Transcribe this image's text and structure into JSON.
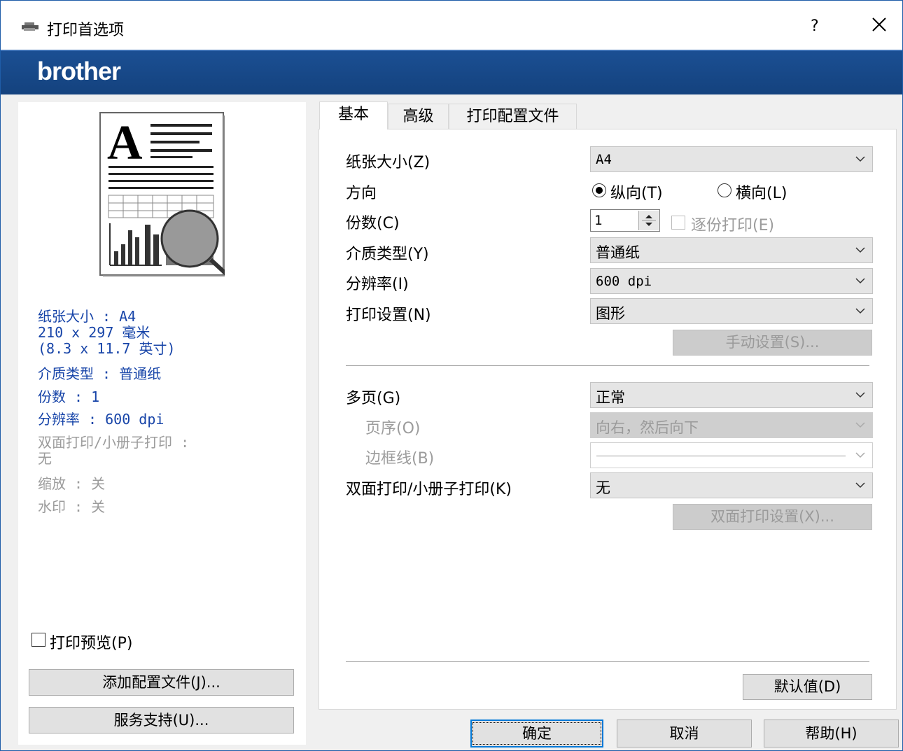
{
  "window": {
    "title": "打印首选项",
    "help": "?",
    "close": "✕"
  },
  "brand": {
    "logo": "brother"
  },
  "summary": {
    "paper_size": "纸张大小 : A4",
    "paper_dims": "210 x 297 毫米",
    "paper_inches": "(8.3 x 11.7 英寸)",
    "media_type": "介质类型 : 普通纸",
    "copies": "份数 : 1",
    "resolution": "分辨率 : 600 dpi",
    "duplex_line1": "双面打印/小册子打印 :",
    "duplex_line2": "无",
    "scaling": "缩放 : 关",
    "watermark": "水印 : 关"
  },
  "left": {
    "print_preview_label": "打印预览(P)",
    "add_profile_button": "添加配置文件(J)...",
    "support_button": "服务支持(U)..."
  },
  "tabs": [
    {
      "label": "基本",
      "active": true
    },
    {
      "label": "高级",
      "active": false
    },
    {
      "label": "打印配置文件",
      "active": false
    }
  ],
  "basic": {
    "paper_size_label": "纸张大小(Z)",
    "paper_size_value": "A4",
    "orientation_label": "方向",
    "portrait_label": "纵向(T)",
    "landscape_label": "横向(L)",
    "orientation_selected": "portrait",
    "copies_label": "份数(C)",
    "copies_value": "1",
    "collate_label": "逐份打印(E)",
    "media_type_label": "介质类型(Y)",
    "media_type_value": "普通纸",
    "resolution_label": "分辨率(I)",
    "resolution_value": "600 dpi",
    "print_settings_label": "打印设置(N)",
    "print_settings_value": "图形",
    "manual_settings_button": "手动设置(S)...",
    "multi_page_label": "多页(G)",
    "multi_page_value": "正常",
    "page_order_label": "页序(O)",
    "page_order_value": "向右，然后向下",
    "border_line_label": "边框线(B)",
    "duplex_label": "双面打印/小册子打印(K)",
    "duplex_value": "无",
    "duplex_settings_button": "双面打印设置(X)...",
    "default_button": "默认值(D)"
  },
  "footer": {
    "ok_button": "确定",
    "cancel_button": "取消",
    "help_button": "帮助(H)"
  },
  "colors": {
    "brand_bar": "#1b4f93",
    "summary_text": "#1744a8",
    "disabled_text": "#9c9c9c",
    "focus_border": "#0078d7"
  }
}
